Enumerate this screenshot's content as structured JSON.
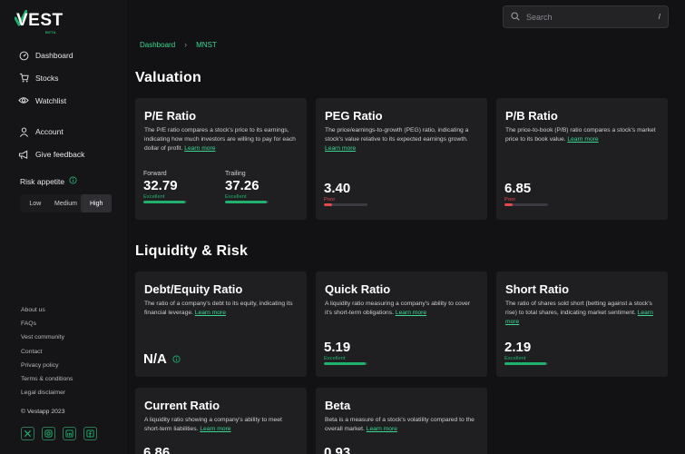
{
  "app": {
    "logo_text": "VEST",
    "logo_badge": "BETA"
  },
  "search": {
    "placeholder": "Search",
    "shortcut": "/"
  },
  "sidebar": {
    "nav": [
      {
        "label": "Dashboard",
        "icon": "dashboard-icon"
      },
      {
        "label": "Stocks",
        "icon": "stocks-icon"
      },
      {
        "label": "Watchlist",
        "icon": "watchlist-icon"
      }
    ],
    "account": [
      {
        "label": "Account",
        "icon": "user-icon"
      },
      {
        "label": "Give feedback",
        "icon": "megaphone-icon"
      }
    ],
    "risk_label": "Risk appetite",
    "risk_options": [
      "Low",
      "Medium",
      "High"
    ],
    "risk_selected": "High",
    "footer_links": [
      "About us",
      "FAQs",
      "Vest community",
      "Contact",
      "Privacy policy",
      "Terms & conditions",
      "Legal disclaimer"
    ],
    "copyright": "© Vestapp 2023",
    "socials": [
      "x-icon",
      "instagram-icon",
      "linkedin-icon",
      "facebook-icon"
    ]
  },
  "breadcrumb": [
    "Dashboard",
    "MNST"
  ],
  "colors": {
    "accent": "#1fb16d",
    "excellent": "#1fb16d",
    "poor": "#e5484d",
    "card_bg": "#1f1f22",
    "page_bg": "#121214"
  },
  "sections": {
    "valuation": {
      "title": "Valuation",
      "pe": {
        "title": "P/E Ratio",
        "desc": "The P/E ratio compares a stock's price to its earnings, indicating how much investors are willing to pay for each dollar of profit.",
        "learn_more": "Learn more",
        "forward": {
          "label": "Forward",
          "value": "32.79",
          "status": "Excellent",
          "level": 0.95
        },
        "trailing": {
          "label": "Trailing",
          "value": "37.26",
          "status": "Excellent",
          "level": 0.95
        }
      },
      "peg": {
        "title": "PEG Ratio",
        "desc": "The price/earnings-to-growth (PEG) ratio, indicating a stock's value relative to its expected earnings growth.",
        "learn_more": "Learn more",
        "value": "3.40",
        "status": "Poor",
        "level": 0.18
      },
      "pb": {
        "title": "P/B Ratio",
        "desc": "The price-to-book (P/B) ratio compares a stock's market price to its book value.",
        "learn_more": "Learn more",
        "value": "6.85",
        "status": "Poor",
        "level": 0.18
      }
    },
    "liquidity": {
      "title": "Liquidity & Risk",
      "de": {
        "title": "Debt/Equity Ratio",
        "desc": "The ratio of a company's debt to its equity, indicating its financial leverage.",
        "learn_more": "Learn more",
        "value": "N/A"
      },
      "quick": {
        "title": "Quick Ratio",
        "desc": "A liquidity ratio measuring a company's ability to cover it's short-term obligations.",
        "learn_more": "Learn more",
        "value": "5.19",
        "status": "Excellent",
        "level": 0.95
      },
      "short": {
        "title": "Short Ratio",
        "desc": "The ratio of shares sold short (betting against a stock's rise) to total shares, indicating market sentiment.",
        "learn_more": "Learn more",
        "value": "2.19",
        "status": "Excellent",
        "level": 0.95
      },
      "current": {
        "title": "Current Ratio",
        "desc": "A liquidity ratio showing a company's ability to meet short-term liabilities.",
        "learn_more": "Learn more",
        "value": "6.86"
      },
      "beta": {
        "title": "Beta",
        "desc": "Beta is a measure of a stock's volatility compared to the overall market.",
        "learn_more": "Learn more",
        "value": "0.93"
      }
    }
  }
}
